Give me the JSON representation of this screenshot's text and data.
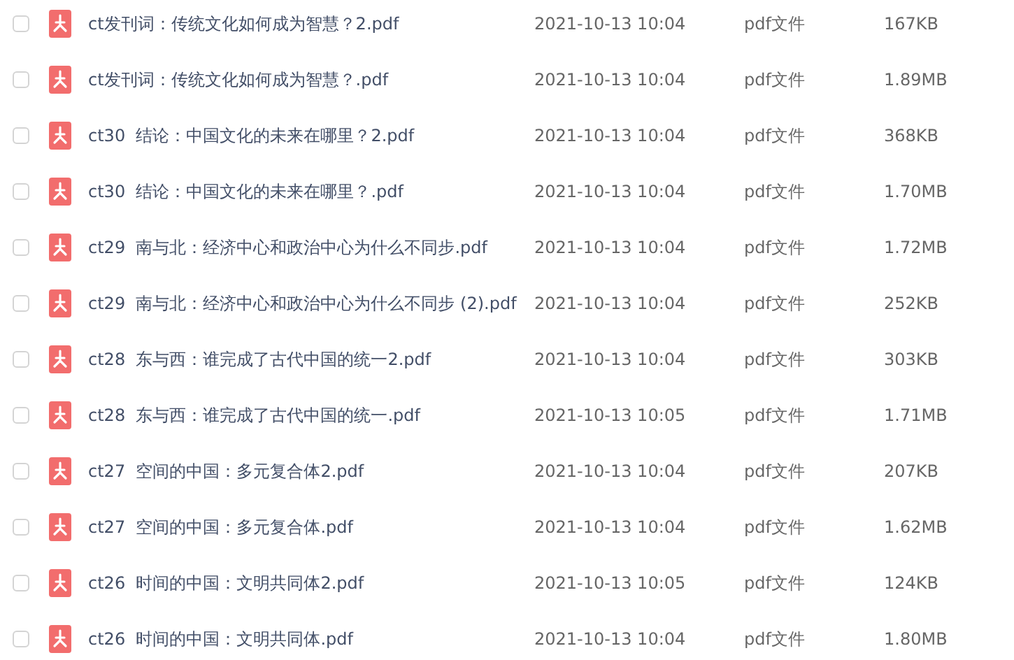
{
  "files": [
    {
      "checked": false,
      "name": "ct发刊词：传统文化如何成为智慧？2.pdf",
      "modified": "2021-10-13 10:04",
      "type": "pdf文件",
      "size": "167KB"
    },
    {
      "checked": false,
      "name": "ct发刊词：传统文化如何成为智慧？.pdf",
      "modified": "2021-10-13 10:04",
      "type": "pdf文件",
      "size": "1.89MB"
    },
    {
      "checked": false,
      "name": "ct30  结论：中国文化的未来在哪里？2.pdf",
      "modified": "2021-10-13 10:04",
      "type": "pdf文件",
      "size": "368KB"
    },
    {
      "checked": false,
      "name": "ct30  结论：中国文化的未来在哪里？.pdf",
      "modified": "2021-10-13 10:04",
      "type": "pdf文件",
      "size": "1.70MB"
    },
    {
      "checked": false,
      "name": "ct29  南与北：经济中心和政治中心为什么不同步.pdf",
      "modified": "2021-10-13 10:04",
      "type": "pdf文件",
      "size": "1.72MB"
    },
    {
      "checked": false,
      "name": "ct29  南与北：经济中心和政治中心为什么不同步 (2).pdf",
      "modified": "2021-10-13 10:04",
      "type": "pdf文件",
      "size": "252KB"
    },
    {
      "checked": false,
      "name": "ct28  东与西：谁完成了古代中国的统一2.pdf",
      "modified": "2021-10-13 10:04",
      "type": "pdf文件",
      "size": "303KB"
    },
    {
      "checked": false,
      "name": "ct28  东与西：谁完成了古代中国的统一.pdf",
      "modified": "2021-10-13 10:05",
      "type": "pdf文件",
      "size": "1.71MB"
    },
    {
      "checked": false,
      "name": "ct27  空间的中国：多元复合体2.pdf",
      "modified": "2021-10-13 10:04",
      "type": "pdf文件",
      "size": "207KB"
    },
    {
      "checked": false,
      "name": "ct27  空间的中国：多元复合体.pdf",
      "modified": "2021-10-13 10:04",
      "type": "pdf文件",
      "size": "1.62MB"
    },
    {
      "checked": false,
      "name": "ct26  时间的中国：文明共同体2.pdf",
      "modified": "2021-10-13 10:05",
      "type": "pdf文件",
      "size": "124KB"
    },
    {
      "checked": false,
      "name": "ct26  时间的中国：文明共同体.pdf",
      "modified": "2021-10-13 10:04",
      "type": "pdf文件",
      "size": "1.80MB"
    }
  ]
}
